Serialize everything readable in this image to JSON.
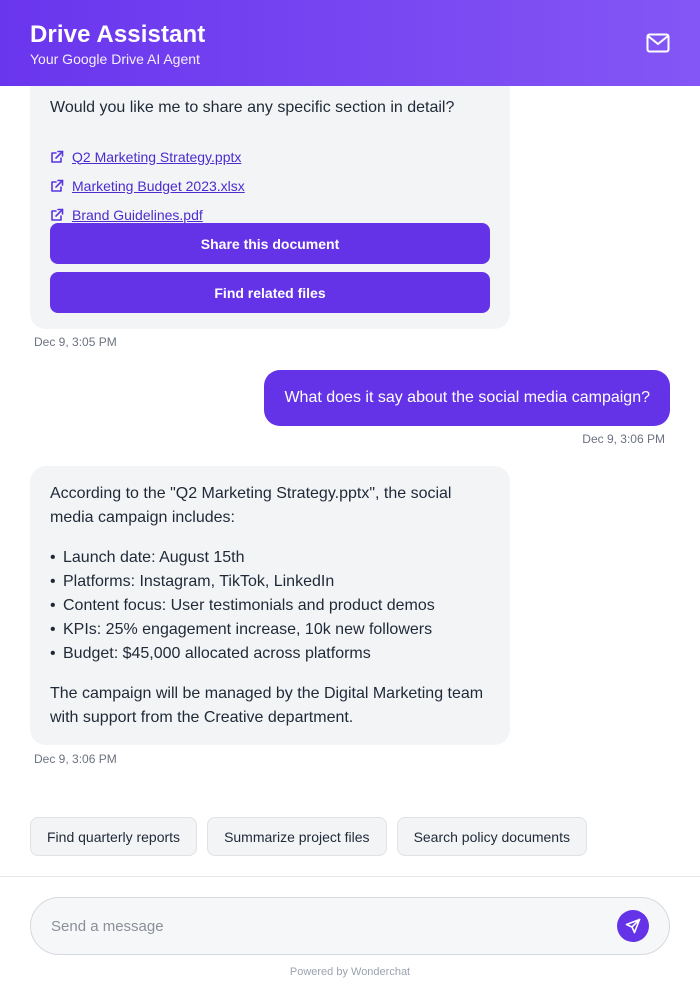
{
  "header": {
    "title": "Drive Assistant",
    "subtitle": "Your Google Drive AI Agent",
    "mail_icon": "mail-icon"
  },
  "messages": [
    {
      "role": "assistant",
      "text": "Would you like me to share any specific section in detail?",
      "links": [
        {
          "icon": "external-link-icon",
          "label": "Q2 Marketing Strategy.pptx"
        },
        {
          "icon": "external-link-icon",
          "label": "Marketing Budget 2023.xlsx"
        },
        {
          "icon": "external-link-icon",
          "label": "Brand Guidelines.pdf"
        }
      ],
      "actions": [
        "Share this document",
        "Find related files"
      ],
      "timestamp": "Dec 9, 3:05 PM"
    },
    {
      "role": "user",
      "text": "What does it say about the social media campaign?",
      "timestamp": "Dec 9, 3:06 PM"
    },
    {
      "role": "assistant",
      "intro": "According to the \"Q2 Marketing Strategy.pptx\", the social media campaign includes:",
      "bullets": [
        "Launch date: August 15th",
        "Platforms: Instagram, TikTok, LinkedIn",
        "Content focus: User testimonials and product demos",
        "KPIs: 25% engagement increase, 10k new followers",
        "Budget: $45,000 allocated across platforms"
      ],
      "outro": "The campaign will be managed by the Digital Marketing team with support from the Creative department.",
      "timestamp": "Dec 9, 3:06 PM"
    }
  ],
  "suggestions": [
    "Find quarterly reports",
    "Summarize project files",
    "Search policy documents"
  ],
  "composer": {
    "placeholder": "Send a message",
    "value": "",
    "send_icon": "send-icon"
  },
  "footer": "Powered by Wonderchat",
  "colors": {
    "accent": "#6433e8",
    "header_start": "#6a35ee",
    "header_end": "#8456f5",
    "bubble_bg": "#f3f4f6",
    "link": "#4c2ccf"
  }
}
